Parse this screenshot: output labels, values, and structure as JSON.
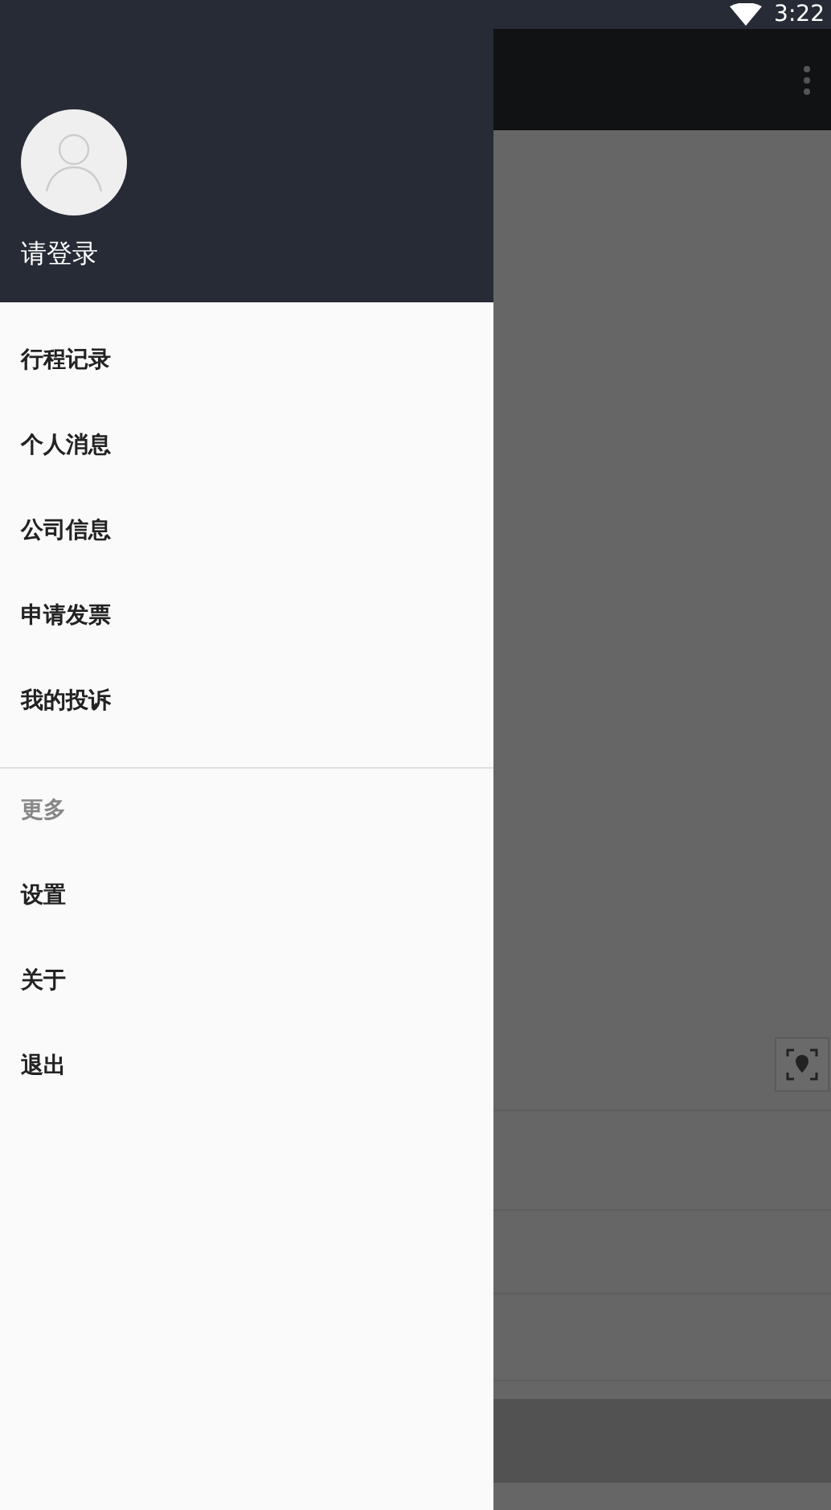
{
  "status_bar": {
    "time": "3:22"
  },
  "drawer": {
    "user_label": "请登录",
    "groups": [
      {
        "items": [
          "行程记录",
          "个人消息",
          "公司信息",
          "申请发票",
          "我的投诉"
        ]
      },
      {
        "header": "更多",
        "items": [
          "设置",
          "关于",
          "退出"
        ]
      }
    ]
  }
}
